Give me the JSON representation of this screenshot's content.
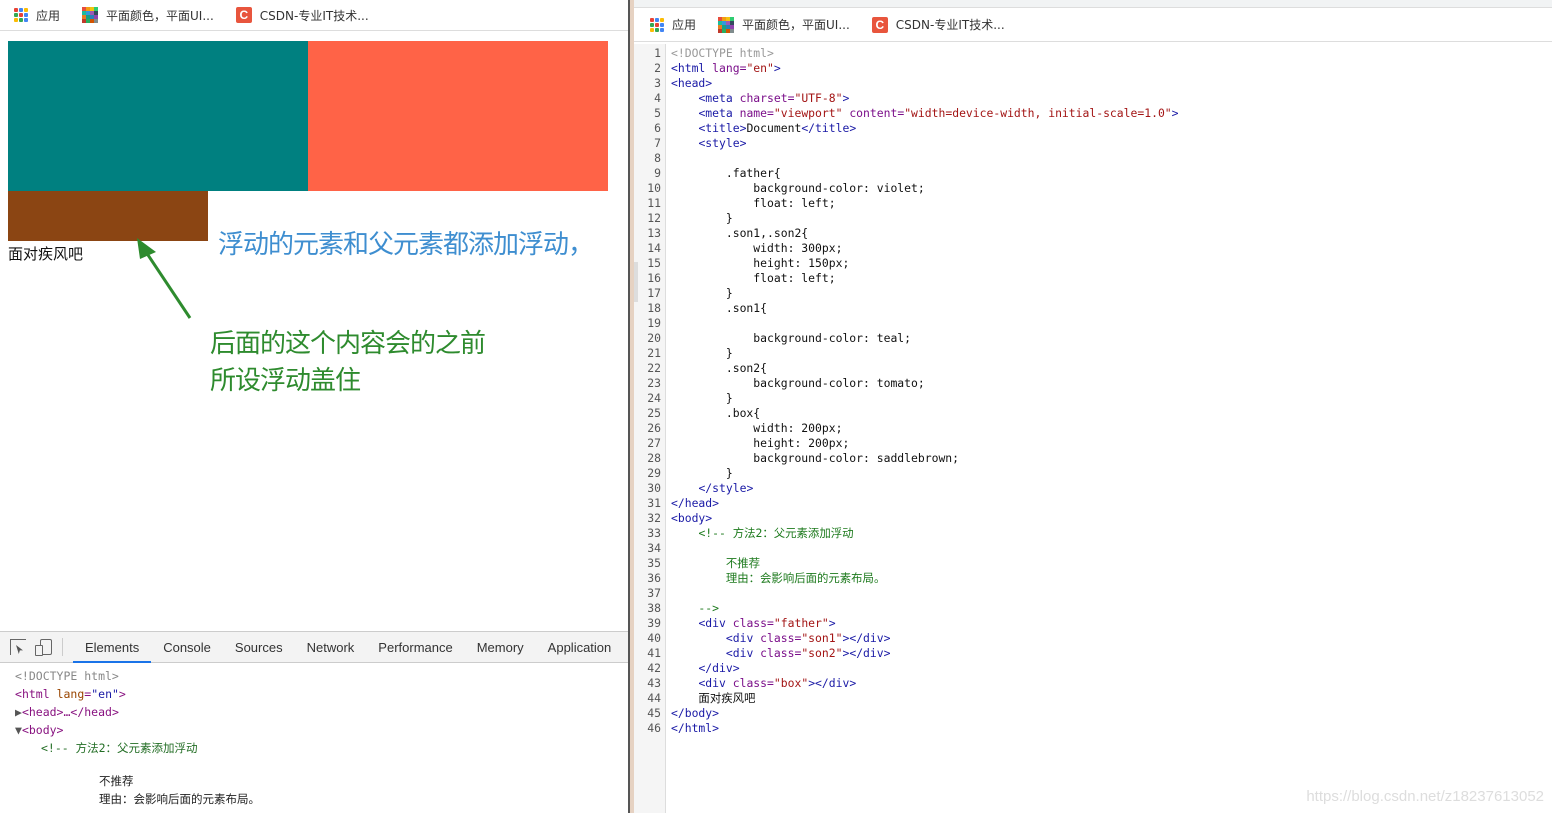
{
  "left": {
    "bookmarks": [
      "应用",
      "平面颜色，平面UI...",
      "CSDN-专业IT技术..."
    ],
    "page_text": "面对疾风吧",
    "devtools": {
      "tabs": [
        "Elements",
        "Console",
        "Sources",
        "Network",
        "Performance",
        "Memory",
        "Application"
      ],
      "active_tab": "Elements",
      "lines": {
        "doctype": "<!DOCTYPE html>",
        "html_tag": "html",
        "html_attr": "lang",
        "html_val": "\"en\"",
        "head": "<head>…</head>",
        "body": "<body>",
        "comment1": "<!-- 方法2：父元素添加浮动",
        "comment2": "不推荐",
        "comment3": "理由：会影响后面的元素布局。"
      }
    }
  },
  "right": {
    "bookmarks": [
      "应用",
      "平面颜色，平面UI...",
      "CSDN-专业IT技术..."
    ],
    "code_lines": [
      [
        [
          "c-doc",
          "<!DOCTYPE html>"
        ]
      ],
      [
        [
          "c-tag",
          "<html "
        ],
        [
          "c-name",
          "lang="
        ],
        [
          "c-val",
          "\"en\""
        ],
        [
          "c-tag",
          ">"
        ]
      ],
      [
        [
          "c-tag",
          "<head>"
        ]
      ],
      [
        [
          "c-txt",
          "    "
        ],
        [
          "c-tag",
          "<meta "
        ],
        [
          "c-name",
          "charset="
        ],
        [
          "c-val",
          "\"UTF-8\""
        ],
        [
          "c-tag",
          ">"
        ]
      ],
      [
        [
          "c-txt",
          "    "
        ],
        [
          "c-tag",
          "<meta "
        ],
        [
          "c-name",
          "name="
        ],
        [
          "c-val",
          "\"viewport\""
        ],
        [
          "c-name",
          " content="
        ],
        [
          "c-val",
          "\"width=device-width, initial-scale=1.0\""
        ],
        [
          "c-tag",
          ">"
        ]
      ],
      [
        [
          "c-txt",
          "    "
        ],
        [
          "c-tag",
          "<title>"
        ],
        [
          "c-txt",
          "Document"
        ],
        [
          "c-tag",
          "</title>"
        ]
      ],
      [
        [
          "c-txt",
          "    "
        ],
        [
          "c-tag",
          "<style>"
        ]
      ],
      [
        [
          "c-txt",
          ""
        ]
      ],
      [
        [
          "c-sel",
          "        .father{"
        ]
      ],
      [
        [
          "c-sel",
          "            background-color: violet;"
        ]
      ],
      [
        [
          "c-sel",
          "            float: left;"
        ]
      ],
      [
        [
          "c-sel",
          "        }"
        ]
      ],
      [
        [
          "c-sel",
          "        .son1,.son2{"
        ]
      ],
      [
        [
          "c-sel",
          "            width: 300px;"
        ]
      ],
      [
        [
          "c-sel",
          "            height: 150px;"
        ]
      ],
      [
        [
          "c-sel",
          "            float: left;"
        ]
      ],
      [
        [
          "c-sel",
          "        }"
        ]
      ],
      [
        [
          "c-sel",
          "        .son1{"
        ]
      ],
      [
        [
          "c-txt",
          ""
        ]
      ],
      [
        [
          "c-sel",
          "            background-color: teal;"
        ]
      ],
      [
        [
          "c-sel",
          "        }"
        ]
      ],
      [
        [
          "c-sel",
          "        .son2{"
        ]
      ],
      [
        [
          "c-sel",
          "            background-color: tomato;"
        ]
      ],
      [
        [
          "c-sel",
          "        }"
        ]
      ],
      [
        [
          "c-sel",
          "        .box{"
        ]
      ],
      [
        [
          "c-sel",
          "            width: 200px;"
        ]
      ],
      [
        [
          "c-sel",
          "            height: 200px;"
        ]
      ],
      [
        [
          "c-sel",
          "            background-color: saddlebrown;"
        ]
      ],
      [
        [
          "c-sel",
          "        }"
        ]
      ],
      [
        [
          "c-txt",
          "    "
        ],
        [
          "c-tag",
          "</style>"
        ]
      ],
      [
        [
          "c-tag",
          "</head>"
        ]
      ],
      [
        [
          "c-tag",
          "<body>"
        ]
      ],
      [
        [
          "c-txt",
          "    "
        ],
        [
          "c-cmt",
          "<!-- 方法2：父元素添加浮动"
        ]
      ],
      [
        [
          "c-txt",
          ""
        ]
      ],
      [
        [
          "c-cmt",
          "        不推荐"
        ]
      ],
      [
        [
          "c-cmt",
          "        理由：会影响后面的元素布局。"
        ]
      ],
      [
        [
          "c-txt",
          ""
        ]
      ],
      [
        [
          "c-cmt",
          "    -->"
        ]
      ],
      [
        [
          "c-txt",
          "    "
        ],
        [
          "c-tag",
          "<div "
        ],
        [
          "c-name",
          "class="
        ],
        [
          "c-val",
          "\"father\""
        ],
        [
          "c-tag",
          ">"
        ]
      ],
      [
        [
          "c-txt",
          "        "
        ],
        [
          "c-tag",
          "<div "
        ],
        [
          "c-name",
          "class="
        ],
        [
          "c-val",
          "\"son1\""
        ],
        [
          "c-tag",
          "></div>"
        ]
      ],
      [
        [
          "c-txt",
          "        "
        ],
        [
          "c-tag",
          "<div "
        ],
        [
          "c-name",
          "class="
        ],
        [
          "c-val",
          "\"son2\""
        ],
        [
          "c-tag",
          "></div>"
        ]
      ],
      [
        [
          "c-txt",
          "    "
        ],
        [
          "c-tag",
          "</div>"
        ]
      ],
      [
        [
          "c-txt",
          "    "
        ],
        [
          "c-tag",
          "<div "
        ],
        [
          "c-name",
          "class="
        ],
        [
          "c-val",
          "\"box\""
        ],
        [
          "c-tag",
          "></div>"
        ]
      ],
      [
        [
          "c-txt",
          "    面对疾风吧"
        ]
      ],
      [
        [
          "c-tag",
          "</body>"
        ]
      ],
      [
        [
          "c-tag",
          "</html>"
        ]
      ]
    ],
    "watermark": "https://blog.csdn.net/z18237613052"
  },
  "annotations": {
    "blue": "浮动的元素和父元素都添加浮动，",
    "green_line1": "后面的这个内容会的之前",
    "green_line2": "所设浮动盖住"
  },
  "colors": {
    "son1": "#008080",
    "son2": "#ff6347",
    "box": "#8b4513",
    "annotation_blue": "#3e8ed0",
    "annotation_green": "#2e8b2e"
  }
}
